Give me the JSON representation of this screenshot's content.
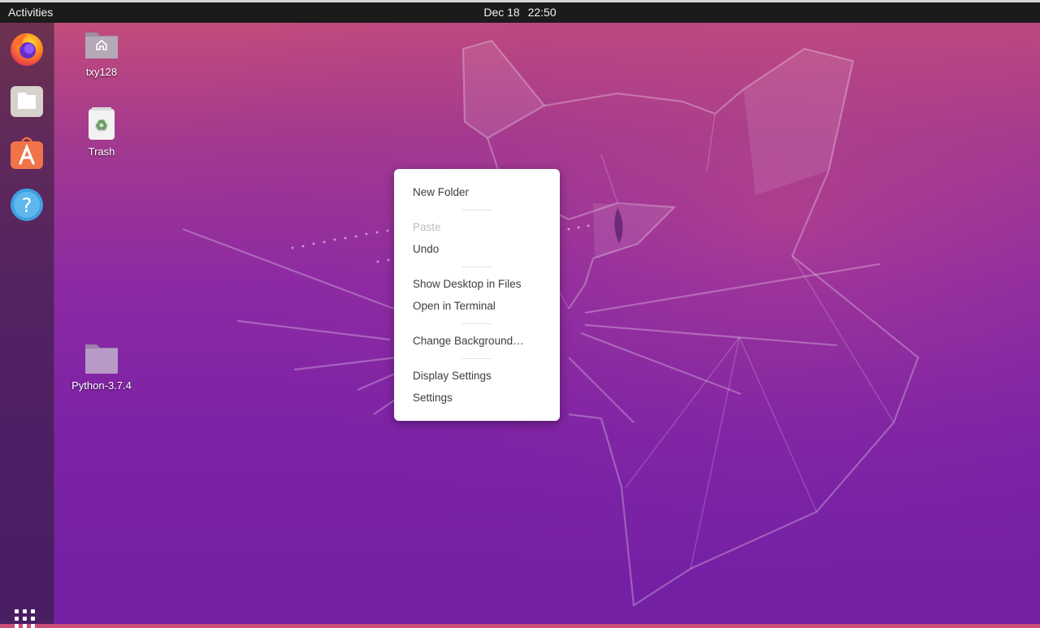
{
  "topbar": {
    "activities_label": "Activities",
    "date": "Dec 18",
    "time": "22:50"
  },
  "dock": {
    "items": [
      {
        "name": "firefox-icon"
      },
      {
        "name": "files-icon"
      },
      {
        "name": "software-icon"
      },
      {
        "name": "help-icon"
      }
    ],
    "show_apps": "show-applications-icon"
  },
  "desktop": {
    "icons": [
      {
        "label": "txy128",
        "kind": "home-folder"
      },
      {
        "label": "Trash",
        "kind": "trash"
      },
      {
        "label": "Python-3.7.4",
        "kind": "folder"
      }
    ]
  },
  "context_menu": {
    "new_folder": "New Folder",
    "paste": "Paste",
    "undo": "Undo",
    "show_desktop_in_files": "Show Desktop in Files",
    "open_in_terminal": "Open in Terminal",
    "change_background": "Change Background…",
    "display_settings": "Display Settings",
    "settings": "Settings"
  },
  "colors": {
    "topbar": "#1b1b1b",
    "wallpaper_top": "#c94f78",
    "wallpaper_bottom": "#7320a4",
    "menu_bg": "#ffffff",
    "disabled_text": "#bdbdbd"
  }
}
